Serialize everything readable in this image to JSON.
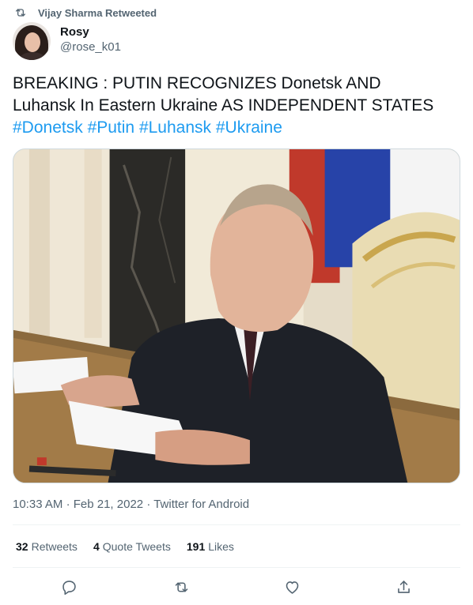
{
  "retweet_banner": {
    "text": "Vijay Sharma Retweeted",
    "icon": "retweet-icon"
  },
  "author": {
    "display_name": "Rosy",
    "handle": "@rose_k01",
    "avatar": "avatar-image"
  },
  "tweet": {
    "line1": "BREAKING : PUTIN RECOGNIZES Donetsk AND",
    "line2": "Luhansk In Eastern Ukraine AS INDEPENDENT STATES",
    "hashtags": [
      "#Donetsk",
      "#Putin",
      "#Luhansk",
      "#Ukraine"
    ]
  },
  "media": {
    "kind": "photo"
  },
  "meta": {
    "time": "10:33 AM",
    "date": "Feb 21, 2022",
    "source": "Twitter for Android",
    "separator": "·"
  },
  "stats": [
    {
      "count": "32",
      "label": "Retweets"
    },
    {
      "count": "4",
      "label": "Quote Tweets"
    },
    {
      "count": "191",
      "label": "Likes"
    }
  ],
  "actions": [
    {
      "name": "reply",
      "icon": "reply-icon"
    },
    {
      "name": "retweet",
      "icon": "retweet-icon"
    },
    {
      "name": "like",
      "icon": "heart-icon"
    },
    {
      "name": "share",
      "icon": "share-icon"
    }
  ],
  "colors": {
    "link": "#1d9bf0",
    "secondary_text": "#536471",
    "primary_text": "#0f1419",
    "divider": "#eff3f4"
  }
}
